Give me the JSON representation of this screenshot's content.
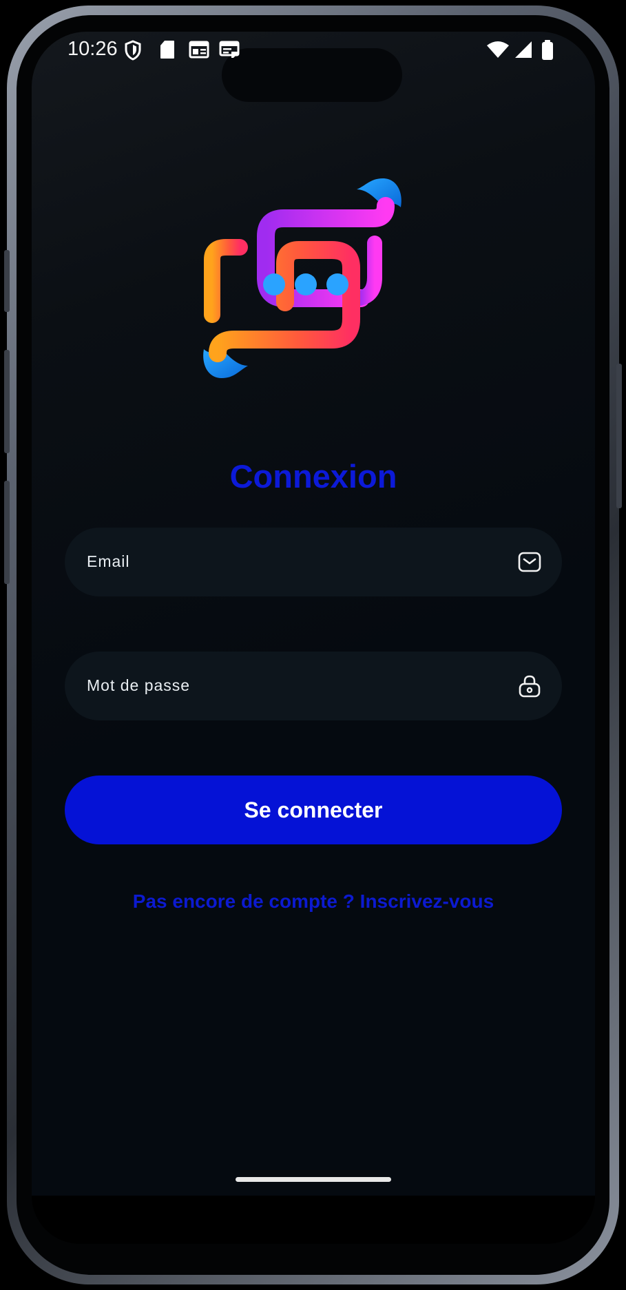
{
  "status_bar": {
    "time": "10:26",
    "icons": [
      "shield-icon",
      "sd-card-icon",
      "news-icon",
      "news-icon-2",
      "wifi-icon",
      "signal-icon",
      "battery-icon"
    ]
  },
  "login": {
    "title": "Connexion",
    "email_placeholder": "Email",
    "password_placeholder": "Mot de passe",
    "submit_label": "Se connecter",
    "signup_link": "Pas encore de compte ? Inscrivez-vous"
  },
  "colors": {
    "accent": "#0512d6",
    "title": "#0c1ad8",
    "field_bg": "#0d151c",
    "background": "#050a10"
  }
}
